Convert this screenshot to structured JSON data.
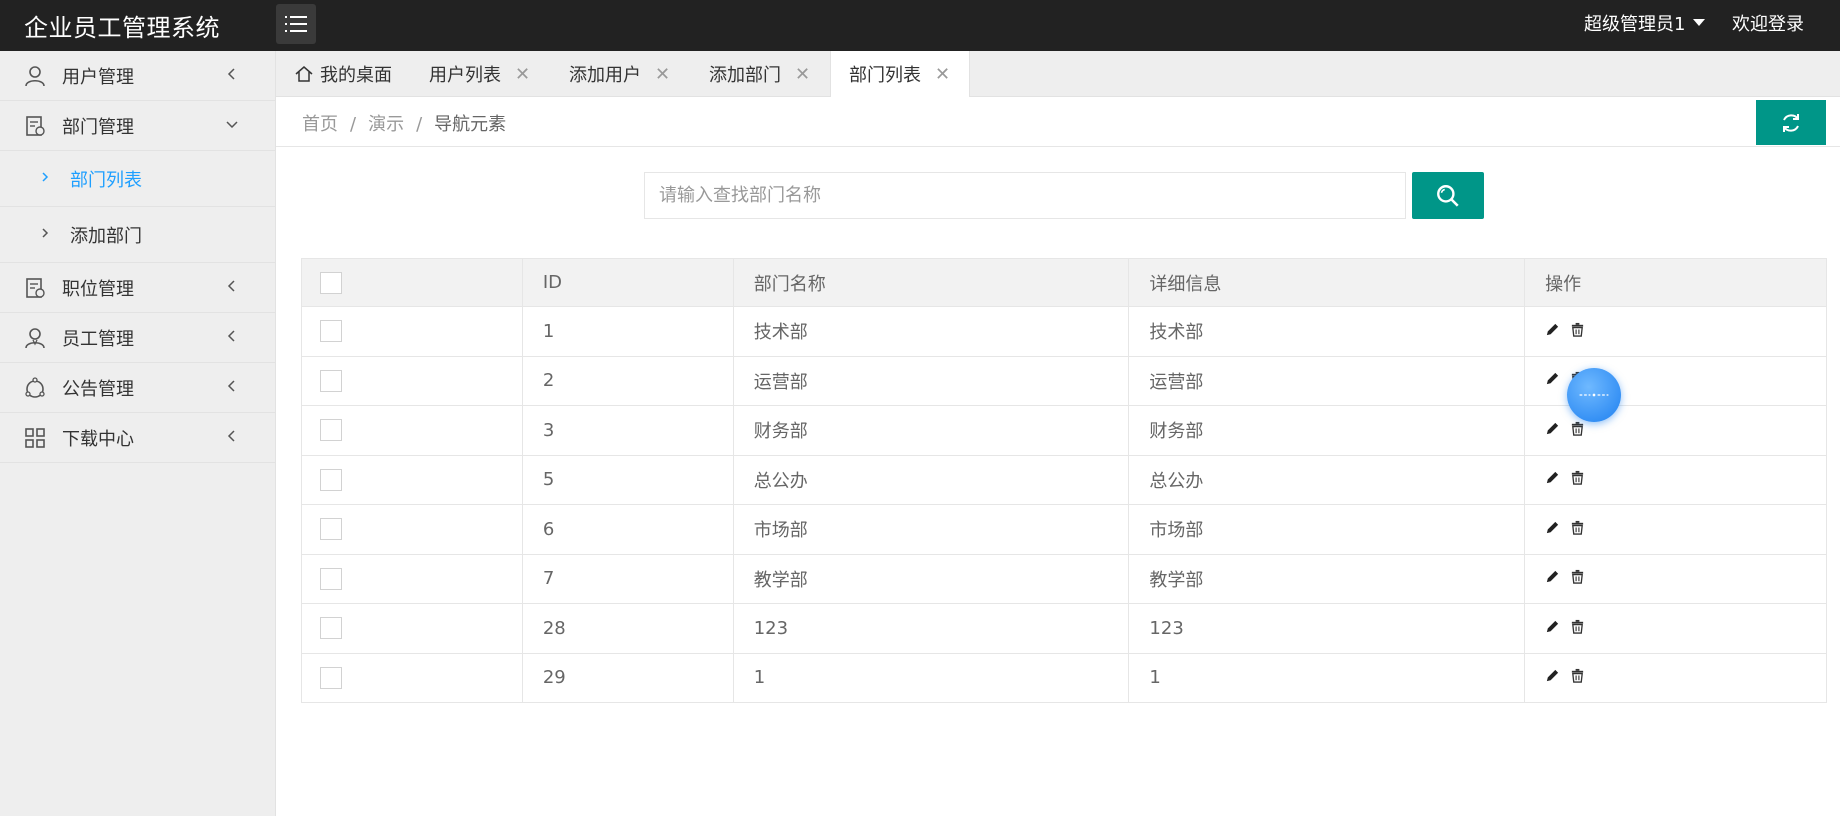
{
  "app": {
    "title": "企业员工管理系统"
  },
  "header": {
    "user": "超级管理员1",
    "welcome": "欢迎登录"
  },
  "sidebar": {
    "items": [
      {
        "label": "用户管理",
        "icon": "user-icon"
      },
      {
        "label": "部门管理",
        "icon": "department-icon"
      },
      {
        "label": "部门列表",
        "icon": "chevron-right-icon",
        "active": true
      },
      {
        "label": "添加部门",
        "icon": "chevron-right-icon"
      },
      {
        "label": "职位管理",
        "icon": "position-icon"
      },
      {
        "label": "员工管理",
        "icon": "employee-icon"
      },
      {
        "label": "公告管理",
        "icon": "announcement-icon"
      },
      {
        "label": "下载中心",
        "icon": "grid-icon"
      }
    ]
  },
  "tabs": [
    {
      "label": "我的桌面",
      "icon": "home-icon"
    },
    {
      "label": "用户列表",
      "close": "✕"
    },
    {
      "label": "添加用户",
      "close": "✕"
    },
    {
      "label": "添加部门",
      "close": "✕"
    },
    {
      "label": "部门列表",
      "close": "✕",
      "active": true
    }
  ],
  "breadcrumb": [
    "首页",
    "演示",
    "导航元素"
  ],
  "breadcrumb_sep": "/",
  "search": {
    "placeholder": "请输入查找部门名称"
  },
  "table": {
    "headers": [
      "",
      "ID",
      "部门名称",
      "详细信息",
      "操作"
    ],
    "rows": [
      {
        "id": "1",
        "name": "技术部",
        "detail": "技术部"
      },
      {
        "id": "2",
        "name": "运营部",
        "detail": "运营部"
      },
      {
        "id": "3",
        "name": "财务部",
        "detail": "财务部"
      },
      {
        "id": "5",
        "name": "总公办",
        "detail": "总公办"
      },
      {
        "id": "6",
        "name": "市场部",
        "detail": "市场部"
      },
      {
        "id": "7",
        "name": "教学部",
        "detail": "教学部"
      },
      {
        "id": "28",
        "name": "123",
        "detail": "123"
      },
      {
        "id": "29",
        "name": "1",
        "detail": "1"
      }
    ]
  },
  "colors": {
    "accent": "#009688",
    "active_link": "#1e9fff",
    "header_bg": "#222222",
    "sidebar_bg": "#eeeeee"
  }
}
